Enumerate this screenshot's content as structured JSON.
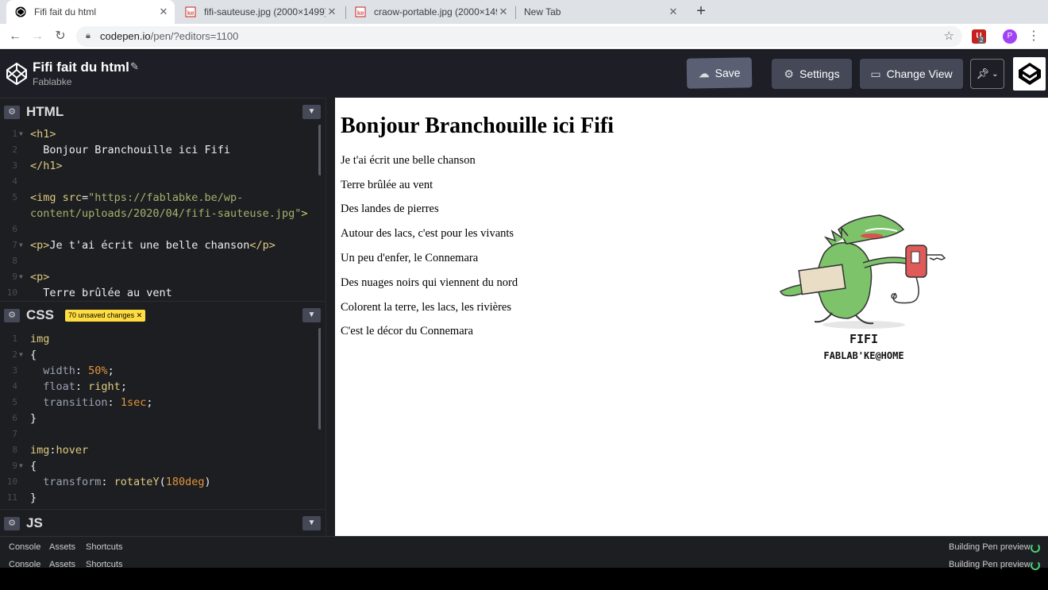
{
  "browser": {
    "tabs": [
      {
        "title": "Fifi fait du html",
        "active": true
      },
      {
        "title": "fifi-sauteuse.jpg (2000×1499)",
        "active": false
      },
      {
        "title": "craow-portable.jpg (2000×1499)",
        "active": false
      },
      {
        "title": "New Tab",
        "active": false
      }
    ],
    "url_host": "codepen.io",
    "url_path": "/pen/?editors=1100",
    "ext_badge": "2",
    "profile_initial": "P"
  },
  "header": {
    "pen_title": "Fifi fait du html",
    "user": "Fablabke",
    "save_label": "Save",
    "settings_label": "Settings",
    "change_view_label": "Change View"
  },
  "panels": {
    "html_label": "HTML",
    "css_label": "CSS",
    "js_label": "JS",
    "unsaved_badge": "70 unsaved changes"
  },
  "html_code": [
    {
      "n": "1",
      "fold": true,
      "parts": [
        [
          "tok-tag",
          "<h1>"
        ]
      ]
    },
    {
      "n": "2",
      "fold": false,
      "parts": [
        [
          "",
          "  Bonjour Branchouille ici Fifi"
        ]
      ]
    },
    {
      "n": "3",
      "fold": false,
      "parts": [
        [
          "tok-tag",
          "</h1>"
        ]
      ]
    },
    {
      "n": "4",
      "fold": false,
      "parts": []
    },
    {
      "n": "5",
      "fold": false,
      "parts": [
        [
          "tok-tag",
          "<img "
        ],
        [
          "tok-attr",
          "src"
        ],
        [
          "",
          "="
        ],
        [
          "tok-str",
          "\"https://fablabke.be/wp-"
        ]
      ]
    },
    {
      "n": "",
      "fold": false,
      "parts": [
        [
          "tok-str",
          "content/uploads/2020/04/fifi-sauteuse.jpg\""
        ],
        [
          "tok-tag",
          ">"
        ]
      ]
    },
    {
      "n": "6",
      "fold": false,
      "parts": []
    },
    {
      "n": "7",
      "fold": true,
      "parts": [
        [
          "tok-tag",
          "<p>"
        ],
        [
          "",
          "Je t'ai écrit une belle chanson"
        ],
        [
          "tok-tag",
          "</p>"
        ]
      ]
    },
    {
      "n": "8",
      "fold": false,
      "parts": []
    },
    {
      "n": "9",
      "fold": true,
      "parts": [
        [
          "tok-tag",
          "<p>"
        ]
      ]
    },
    {
      "n": "10",
      "fold": false,
      "parts": [
        [
          "",
          "  Terre brûlée au vent"
        ]
      ]
    }
  ],
  "css_code": [
    {
      "n": "1",
      "fold": false,
      "parts": [
        [
          "tok-sel",
          "img"
        ]
      ]
    },
    {
      "n": "2",
      "fold": true,
      "parts": [
        [
          "",
          "{"
        ]
      ]
    },
    {
      "n": "3",
      "fold": false,
      "parts": [
        [
          "tok-prop",
          "  width"
        ],
        [
          "",
          ": "
        ],
        [
          "tok-num",
          "50%"
        ],
        [
          "",
          ";"
        ]
      ]
    },
    {
      "n": "4",
      "fold": false,
      "parts": [
        [
          "tok-prop",
          "  float"
        ],
        [
          "",
          ": "
        ],
        [
          "tok-val",
          "right"
        ],
        [
          "",
          ";"
        ]
      ]
    },
    {
      "n": "5",
      "fold": false,
      "parts": [
        [
          "tok-prop",
          "  transition"
        ],
        [
          "",
          ": "
        ],
        [
          "tok-num",
          "1sec"
        ],
        [
          "",
          ";"
        ]
      ]
    },
    {
      "n": "6",
      "fold": false,
      "parts": [
        [
          "",
          "}"
        ]
      ]
    },
    {
      "n": "7",
      "fold": false,
      "parts": []
    },
    {
      "n": "8",
      "fold": false,
      "parts": [
        [
          "tok-sel",
          "img"
        ],
        [
          "",
          ":"
        ],
        [
          "tok-val",
          "hover"
        ]
      ]
    },
    {
      "n": "9",
      "fold": true,
      "parts": [
        [
          "",
          "{"
        ]
      ]
    },
    {
      "n": "10",
      "fold": false,
      "parts": [
        [
          "tok-prop",
          "  transform"
        ],
        [
          "",
          ": "
        ],
        [
          "tok-val",
          "rotateY"
        ],
        [
          "",
          "("
        ],
        [
          "tok-num",
          "180deg"
        ],
        [
          "",
          ")"
        ]
      ]
    },
    {
      "n": "11",
      "fold": false,
      "parts": [
        [
          "",
          "}"
        ]
      ]
    }
  ],
  "preview": {
    "heading": "Bonjour Branchouille ici Fifi",
    "paragraphs": [
      "Je t'ai écrit une belle chanson",
      "Terre brûlée au vent",
      "Des landes de pierres",
      "Autour des lacs, c'est pour les vivants",
      "Un peu d'enfer, le Connemara",
      "Des nuages noirs qui viennent du nord",
      "Colorent la terre, les lacs, les rivières",
      "C'est le décor du Connemara"
    ],
    "image_caption_1": "FIFI",
    "image_caption_2": "FABLAB'KE@HOME"
  },
  "bottom": {
    "console_label": "Console",
    "assets_label": "Assets",
    "shortcuts_label": "Shortcuts",
    "status": "Building Pen preview"
  }
}
